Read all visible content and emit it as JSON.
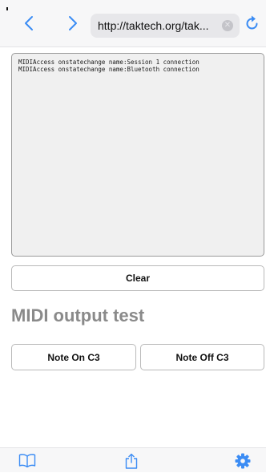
{
  "browser": {
    "address_bar": {
      "url": "http://taktech.org/tak...",
      "clear_icon": "clear-circle-icon"
    },
    "nav": {
      "back_icon": "chevron-left-icon",
      "forward_icon": "chevron-right-icon",
      "reload_icon": "reload-icon"
    },
    "toolbar": {
      "icons": [
        "bookmarks-icon",
        "share-icon",
        "gear-icon"
      ]
    },
    "accent_color": "#3b8cf4"
  },
  "log": {
    "lines": [
      "MIDIAccess onstatechange name:Session 1 connection",
      "MIDIAccess onstatechange name:Bluetooth connection"
    ]
  },
  "buttons": {
    "clear": "Clear",
    "note_on": "Note On C3",
    "note_off": "Note Off C3"
  },
  "sections": {
    "midi_output_title": "MIDI output test"
  }
}
